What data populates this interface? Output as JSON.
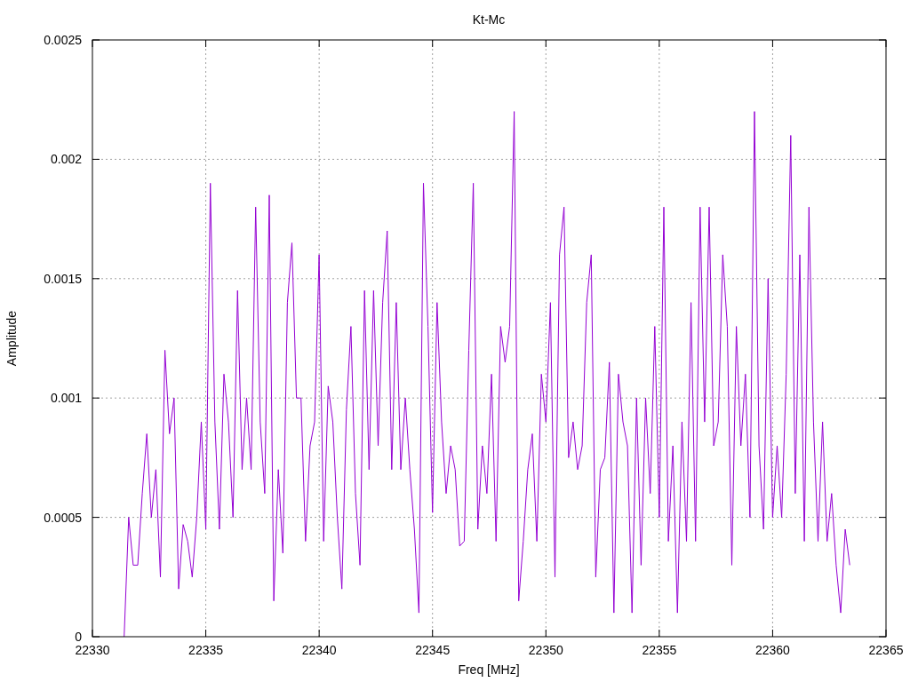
{
  "chart_data": {
    "type": "line",
    "grid": true,
    "title": "Kt-Mc",
    "xlabel": "Freq [MHz]",
    "ylabel": "Amplitude",
    "xlim": [
      22330,
      22365
    ],
    "ylim": [
      0,
      0.0025
    ],
    "xticks": [
      22330,
      22335,
      22340,
      22345,
      22350,
      22355,
      22360,
      22365
    ],
    "yticks": [
      {
        "value": 0,
        "label": "0"
      },
      {
        "value": 0.0005,
        "label": "0.0005"
      },
      {
        "value": 0.001,
        "label": "0.001"
      },
      {
        "value": 0.0015,
        "label": "0.0015"
      },
      {
        "value": 0.002,
        "label": "0.002"
      },
      {
        "value": 0.0025,
        "label": "0.0025"
      }
    ],
    "x": [
      22331.4,
      22331.6,
      22331.8,
      22332.0,
      22332.2,
      22332.4,
      22332.6,
      22332.8,
      22333.0,
      22333.2,
      22333.4,
      22333.6,
      22333.8,
      22334.0,
      22334.2,
      22334.4,
      22334.6,
      22334.8,
      22335.0,
      22335.2,
      22335.4,
      22335.6,
      22335.8,
      22336.0,
      22336.2,
      22336.4,
      22336.6,
      22336.8,
      22337.0,
      22337.2,
      22337.4,
      22337.6,
      22337.8,
      22338.0,
      22338.2,
      22338.4,
      22338.6,
      22338.8,
      22339.0,
      22339.2,
      22339.4,
      22339.6,
      22339.8,
      22340.0,
      22340.2,
      22340.4,
      22340.6,
      22340.8,
      22341.0,
      22341.2,
      22341.4,
      22341.6,
      22341.8,
      22342.0,
      22342.2,
      22342.4,
      22342.6,
      22342.8,
      22343.0,
      22343.2,
      22343.4,
      22343.6,
      22343.8,
      22344.0,
      22344.2,
      22344.4,
      22344.6,
      22344.8,
      22345.0,
      22345.2,
      22345.4,
      22345.6,
      22345.8,
      22346.0,
      22346.2,
      22346.4,
      22346.6,
      22346.8,
      22347.0,
      22347.2,
      22347.4,
      22347.6,
      22347.8,
      22348.0,
      22348.2,
      22348.4,
      22348.6,
      22348.8,
      22349.0,
      22349.2,
      22349.4,
      22349.6,
      22349.8,
      22350.0,
      22350.2,
      22350.4,
      22350.6,
      22350.8,
      22351.0,
      22351.2,
      22351.4,
      22351.6,
      22351.8,
      22352.0,
      22352.2,
      22352.4,
      22352.6,
      22352.8,
      22353.0,
      22353.2,
      22353.4,
      22353.6,
      22353.8,
      22354.0,
      22354.2,
      22354.4,
      22354.6,
      22354.8,
      22355.0,
      22355.2,
      22355.4,
      22355.6,
      22355.8,
      22356.0,
      22356.2,
      22356.4,
      22356.6,
      22356.8,
      22357.0,
      22357.2,
      22357.4,
      22357.6,
      22357.8,
      22358.0,
      22358.2,
      22358.4,
      22358.6,
      22358.8,
      22359.0,
      22359.2,
      22359.4,
      22359.6,
      22359.8,
      22360.0,
      22360.2,
      22360.4,
      22360.6,
      22360.8,
      22361.0,
      22361.2,
      22361.4,
      22361.6,
      22361.8,
      22362.0,
      22362.2,
      22362.4,
      22362.6,
      22362.8,
      22363.0,
      22363.2,
      22363.4
    ],
    "series": [
      {
        "color": "#9400d3",
        "values": [
          0,
          0.0005,
          0.0003,
          0.0003,
          0.0006,
          0.00085,
          0.0005,
          0.0007,
          0.00025,
          0.0012,
          0.00085,
          0.001,
          0.0002,
          0.00047,
          0.0004,
          0.00025,
          0.0005,
          0.0009,
          0.00045,
          0.0019,
          0.0009,
          0.00045,
          0.0011,
          0.0009,
          0.0005,
          0.00145,
          0.0007,
          0.001,
          0.0007,
          0.0018,
          0.0009,
          0.0006,
          0.00185,
          0.00015,
          0.0007,
          0.00035,
          0.0014,
          0.00165,
          0.001,
          0.001,
          0.0004,
          0.0008,
          0.0009,
          0.0016,
          0.0004,
          0.00105,
          0.0009,
          0.0005,
          0.0002,
          0.00095,
          0.0013,
          0.0006,
          0.0003,
          0.00145,
          0.0007,
          0.00145,
          0.0008,
          0.0014,
          0.0017,
          0.0007,
          0.0014,
          0.0007,
          0.001,
          0.0007,
          0.00045,
          0.0001,
          0.0019,
          0.0013,
          0.00052,
          0.0014,
          0.0009,
          0.0006,
          0.0008,
          0.0007,
          0.00038,
          0.0004,
          0.0012,
          0.0019,
          0.00045,
          0.0008,
          0.0006,
          0.0011,
          0.0004,
          0.0013,
          0.00115,
          0.0013,
          0.0022,
          0.00015,
          0.0004,
          0.0007,
          0.00085,
          0.0004,
          0.0011,
          0.0009,
          0.0014,
          0.00025,
          0.0016,
          0.0018,
          0.00075,
          0.0009,
          0.0007,
          0.0008,
          0.0014,
          0.0016,
          0.00025,
          0.0007,
          0.00075,
          0.00115,
          0.0001,
          0.0011,
          0.0009,
          0.0008,
          0.0001,
          0.001,
          0.0003,
          0.001,
          0.0006,
          0.0013,
          0.0005,
          0.0018,
          0.0004,
          0.0008,
          0.0001,
          0.0009,
          0.0004,
          0.0014,
          0.0004,
          0.0018,
          0.0009,
          0.0018,
          0.0008,
          0.0009,
          0.0016,
          0.0013,
          0.0003,
          0.0013,
          0.0008,
          0.0011,
          0.0005,
          0.0022,
          0.0008,
          0.00045,
          0.0015,
          0.0005,
          0.0008,
          0.0005,
          0.0011,
          0.0021,
          0.0006,
          0.0016,
          0.0004,
          0.0018,
          0.0009,
          0.0004,
          0.0009,
          0.0004,
          0.0006,
          0.0003,
          0.0001,
          0.00045,
          0.0003
        ]
      }
    ]
  }
}
